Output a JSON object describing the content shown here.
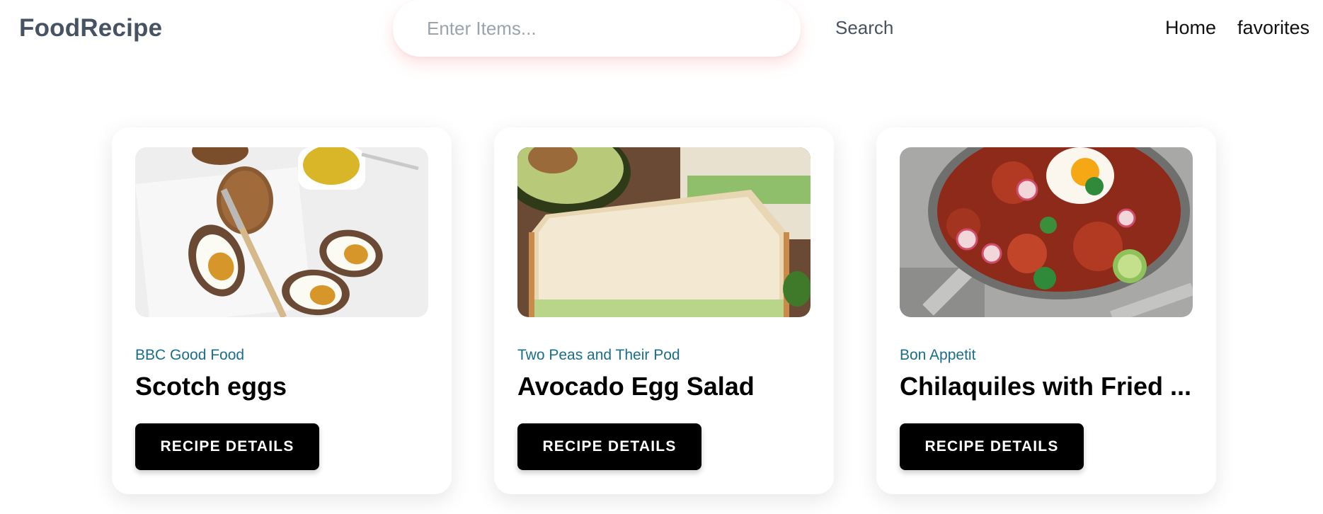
{
  "header": {
    "brand": "FoodRecipe",
    "search_placeholder": "Enter Items...",
    "search_label": "Search",
    "nav": [
      {
        "label": "Home"
      },
      {
        "label": "favorites"
      }
    ]
  },
  "recipes": [
    {
      "publisher": "BBC Good Food",
      "title": "Scotch eggs",
      "button": "RECIPE DETAILS",
      "image": "scotch-eggs-photo"
    },
    {
      "publisher": "Two Peas and Their Pod",
      "title": "Avocado Egg Salad",
      "button": "RECIPE DETAILS",
      "image": "avocado-egg-salad-sandwich-photo"
    },
    {
      "publisher": "Bon Appetit",
      "title": "Chilaquiles with Fried ...",
      "button": "RECIPE DETAILS",
      "image": "chilaquiles-pan-photo"
    }
  ],
  "colors": {
    "brand": "#475263",
    "publisher": "#1a6e8a",
    "button_bg": "#000000",
    "button_text": "#ffffff"
  }
}
